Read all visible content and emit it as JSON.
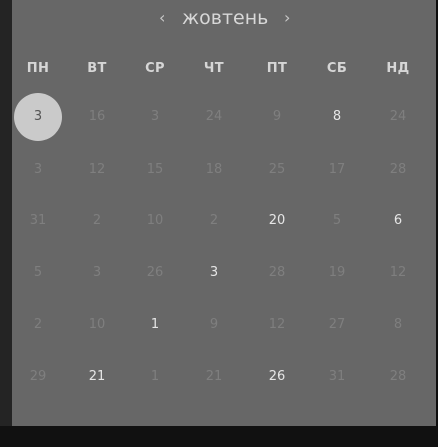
{
  "header": {
    "prev_icon": "‹",
    "month": "жовтень",
    "next_icon": "›"
  },
  "weekdays": [
    "ПН",
    "ВТ",
    "СР",
    "ЧТ",
    "ПТ",
    "СБ",
    "НД"
  ],
  "weeks": [
    [
      "3",
      "16",
      "3",
      "24",
      "9",
      "8",
      "24"
    ],
    [
      "3",
      "12",
      "15",
      "18",
      "25",
      "17",
      "28"
    ],
    [
      "31",
      "2",
      "10",
      "2",
      "20",
      "5",
      "6"
    ],
    [
      "5",
      "3",
      "26",
      "3",
      "28",
      "19",
      "12"
    ],
    [
      "2",
      "10",
      "1",
      "9",
      "12",
      "27",
      "8"
    ],
    [
      "29",
      "21",
      "1",
      "21",
      "26",
      "31",
      "28"
    ]
  ],
  "bright_cells": [
    [
      0,
      5
    ],
    [
      2,
      4
    ],
    [
      2,
      6
    ],
    [
      3,
      3
    ],
    [
      4,
      2
    ],
    [
      5,
      1
    ],
    [
      5,
      4
    ]
  ],
  "selected_cell": [
    0,
    0
  ],
  "colors": {
    "background": "#676767",
    "selected_circle": "#cacaca",
    "dim_text": "#7f7f7f",
    "bright_text": "#e6e6e6"
  }
}
